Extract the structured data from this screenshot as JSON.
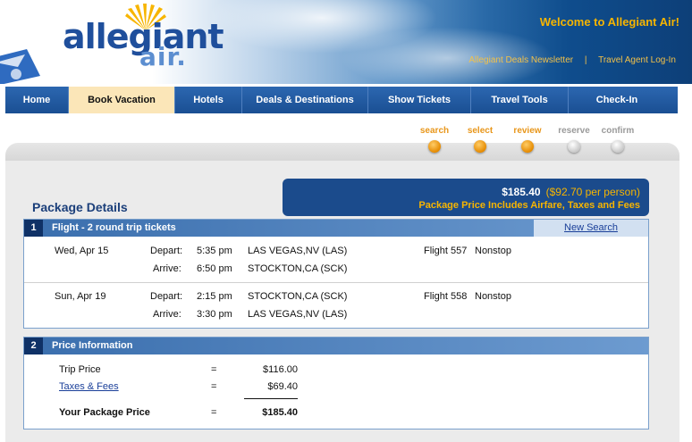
{
  "header": {
    "logo_word1": "allegiant",
    "logo_word2": "air.",
    "welcome": "Welcome to Allegiant Air!",
    "links": [
      "Allegiant Deals Newsletter",
      "Travel Agent Log-In"
    ],
    "link_separator": "|"
  },
  "nav": {
    "items": [
      "Home",
      "Book Vacation",
      "Hotels",
      "Deals & Destinations",
      "Show Tickets",
      "Travel Tools",
      "Check-In"
    ],
    "active": "Book Vacation"
  },
  "steps": [
    {
      "label": "search",
      "state": "done"
    },
    {
      "label": "select",
      "state": "done"
    },
    {
      "label": "review",
      "state": "done"
    },
    {
      "label": "reserve",
      "state": "todo"
    },
    {
      "label": "confirm",
      "state": "todo"
    }
  ],
  "package": {
    "title": "Package Details",
    "price": "$185.40",
    "per_person": "($92.70 per person)",
    "includes": "Package Price Includes Airfare, Taxes and Fees"
  },
  "flights_section": {
    "number": "1",
    "title": "Flight - 2 round trip tickets",
    "new_search": "New Search",
    "depart_label": "Depart:",
    "arrive_label": "Arrive:",
    "legs": [
      {
        "date": "Wed, Apr 15",
        "depart_time": "5:35 pm",
        "depart_city": "LAS VEGAS,NV (LAS)",
        "arrive_time": "6:50 pm",
        "arrive_city": "STOCKTON,CA (SCK)",
        "flight": "Flight 557",
        "stops": "Nonstop"
      },
      {
        "date": "Sun, Apr 19",
        "depart_time": "2:15 pm",
        "depart_city": "STOCKTON,CA (SCK)",
        "arrive_time": "3:30 pm",
        "arrive_city": "LAS VEGAS,NV (LAS)",
        "flight": "Flight 558",
        "stops": "Nonstop"
      }
    ]
  },
  "price_section": {
    "number": "2",
    "title": "Price Information",
    "rows": [
      {
        "label": "Trip Price",
        "eq": "=",
        "amount": "$116.00"
      },
      {
        "label": "Taxes & Fees",
        "eq": "=",
        "amount": "$69.40"
      },
      {
        "label": "Your Package Price",
        "eq": "=",
        "amount": "$185.40"
      }
    ]
  },
  "colors": {
    "brand_blue": "#1b4b8c",
    "accent_orange": "#e8961a",
    "accent_gold": "#f7b500"
  }
}
